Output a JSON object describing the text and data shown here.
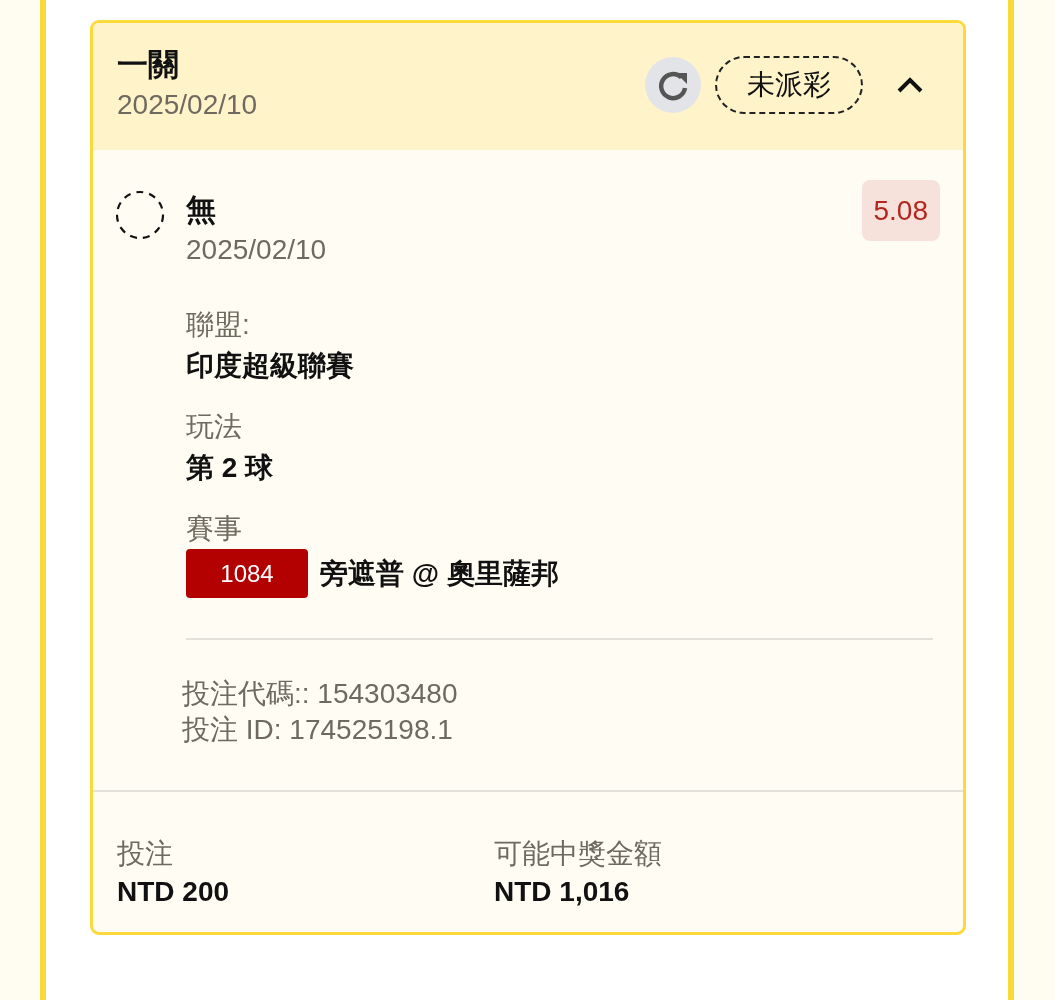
{
  "bet": {
    "title": "一關",
    "date": "2025/02/10",
    "status": "未派彩",
    "expanded": true
  },
  "selection": {
    "name": "無",
    "date": "2025/02/10",
    "odds": "5.08"
  },
  "details": [
    {
      "kind": "text",
      "label": "聯盟:",
      "value": "印度超級聯賽"
    },
    {
      "kind": "text",
      "label": "玩法",
      "value": "第 2 球"
    },
    {
      "kind": "match",
      "label": "賽事",
      "match_number": "1084",
      "value": "旁遮普 @ 奧里薩邦"
    }
  ],
  "references": [
    "投注代碼:: 154303480",
    "投注 ID: 174525198.1"
  ],
  "summary": [
    {
      "label": "投注",
      "value": "NTD 200"
    },
    {
      "label": "可能中獎金額",
      "value": "NTD 1,016"
    }
  ]
}
